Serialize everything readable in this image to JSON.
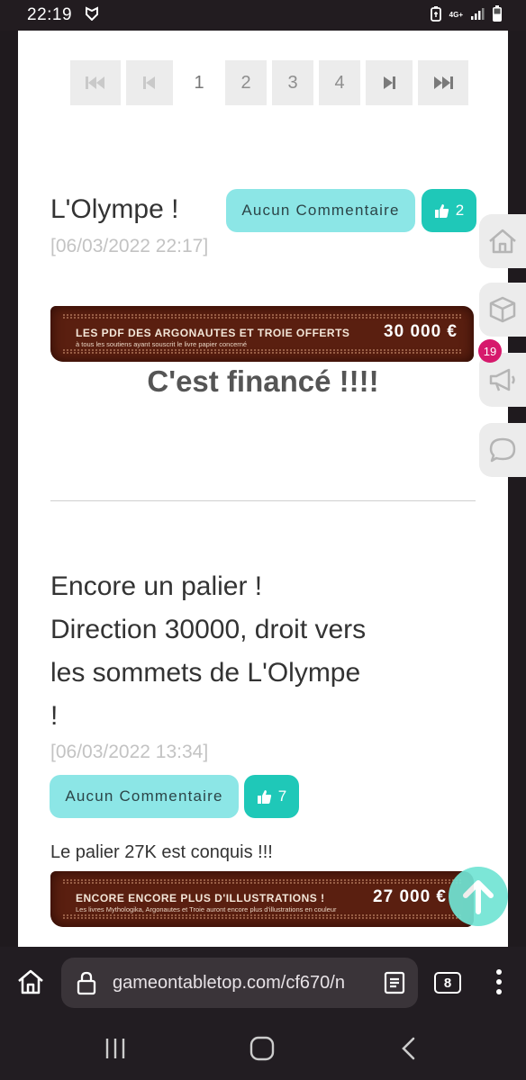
{
  "status_bar": {
    "time": "22:19",
    "network": "4G+"
  },
  "pagination": {
    "pages": [
      "1",
      "2",
      "3",
      "4"
    ],
    "current": "1"
  },
  "posts": [
    {
      "title": "L'Olympe !",
      "date": "[06/03/2022 22:17]",
      "comments_label": "Aucun Commentaire",
      "likes": "2",
      "banner": {
        "main": "LES PDF DES ARGONAUTES ET TROIE OFFERTS",
        "sub": "à tous les soutiens ayant souscrit le livre papier concerné",
        "amount": "30 000 €"
      },
      "headline": "C'est financé !!!!"
    },
    {
      "title": "Encore un palier ! Direction 30000, droit vers les sommets de L'Olympe !",
      "date": "[06/03/2022 13:34]",
      "comments_label": "Aucun Commentaire",
      "likes": "7",
      "text": "Le palier 27K est conquis !!!",
      "banner": {
        "main": "ENCORE ENCORE PLUS D'ILLUSTRATIONS !",
        "sub": "Les livres Mythologika, Argonautes et Troie auront encore plus d'illustrations en couleur",
        "amount": "27 000 €"
      }
    }
  ],
  "side_menu": {
    "notification_count": "19",
    "items": [
      "home-icon",
      "box-icon",
      "megaphone-icon",
      "chat-icon"
    ]
  },
  "browser": {
    "url": "gameontabletop.com/cf670/n",
    "tab_count": "8"
  },
  "colors": {
    "accent": "#1fc8b8",
    "comment_btn": "#8ce6e6",
    "badge": "#d6196c",
    "banner": "#5a1f10"
  }
}
